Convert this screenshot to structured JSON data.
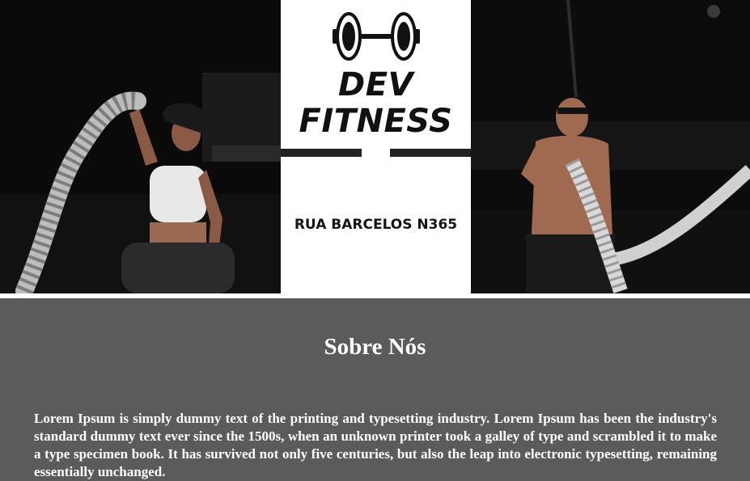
{
  "brand": {
    "logo_icon": "dumbbell-icon",
    "line1": "DEV",
    "line2": "FITNESS",
    "address": "RUA BARCELOS N365"
  },
  "photos": {
    "left": "woman-battle-ropes-photo",
    "right": "man-battle-ropes-photo"
  },
  "about": {
    "title": "Sobre Nós",
    "text": "Lorem Ipsum is simply dummy text of the printing and typesetting industry. Lorem Ipsum has been the industry's standard dummy text ever since the 1500s, when an unknown printer took a galley of type and scrambled it to make a type specimen book. It has survived not only five centuries, but also the leap into electronic typesetting, remaining essentially unchanged."
  },
  "colors": {
    "section_bg": "#5b5b5b",
    "brand_bg": "#ffffff",
    "text_dark": "#111111"
  }
}
